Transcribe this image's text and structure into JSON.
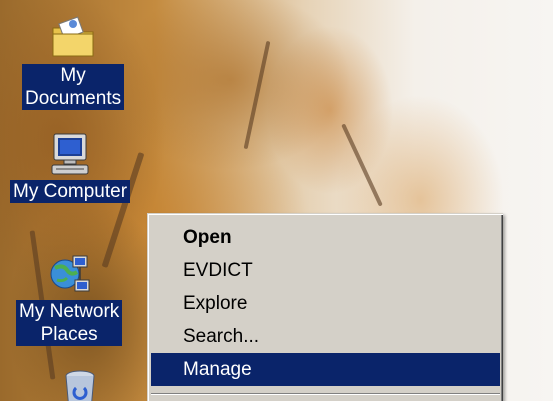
{
  "desktop": {
    "icons": [
      {
        "name": "my-documents",
        "lines": [
          "My",
          "Documents"
        ],
        "icon": "folder-documents-icon"
      },
      {
        "name": "my-computer",
        "lines": [
          "My Computer"
        ],
        "icon": "computer-icon"
      },
      {
        "name": "my-network-places",
        "lines": [
          "My Network",
          "Places"
        ],
        "icon": "network-places-icon"
      },
      {
        "name": "recycle-bin",
        "lines": [],
        "icon": "recycle-bin-icon"
      }
    ]
  },
  "context_menu": {
    "items": [
      {
        "label": "Open",
        "bold": true,
        "selected": false
      },
      {
        "label": "EVDICT",
        "bold": false,
        "selected": false
      },
      {
        "label": "Explore",
        "bold": false,
        "selected": false
      },
      {
        "label": "Search...",
        "bold": false,
        "selected": false
      },
      {
        "label": "Manage",
        "bold": false,
        "selected": true
      }
    ]
  },
  "colors": {
    "selection": "#0a246a",
    "menu_face": "#d4d0c8",
    "label_text": "#ffffff"
  }
}
